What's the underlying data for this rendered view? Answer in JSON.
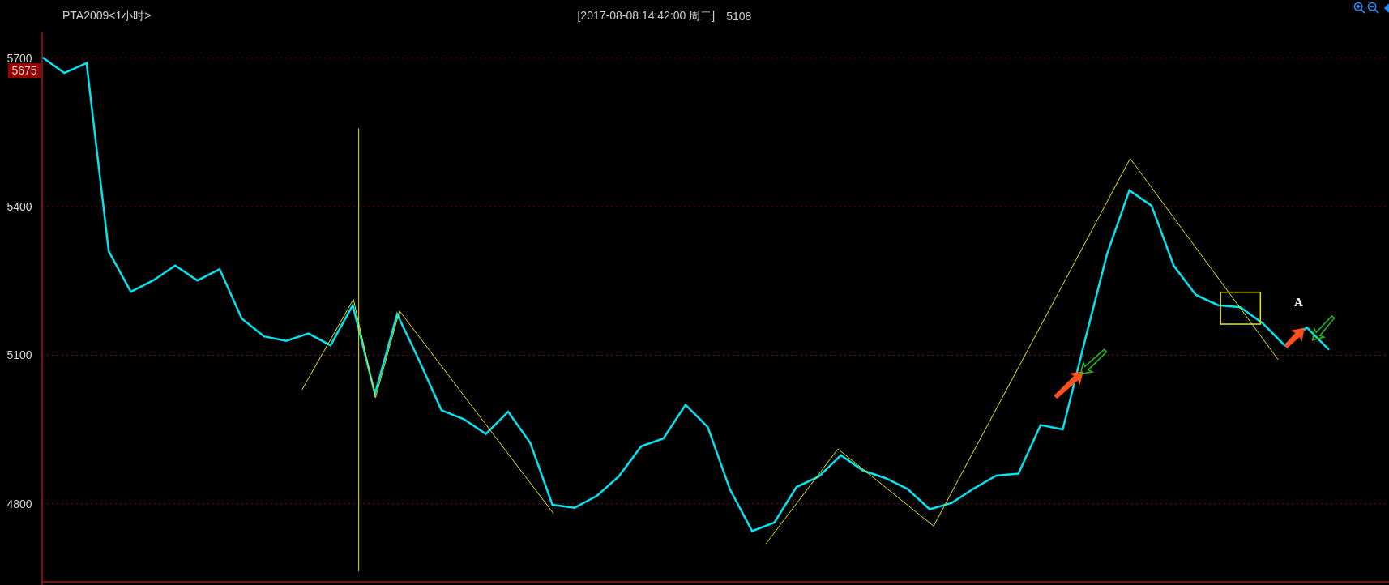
{
  "header": {
    "title": "PTA2009<1小时>",
    "datetime": "[2017-08-08  14:42:00 周二]",
    "price": "5108"
  },
  "chart": {
    "price_tag": "5675",
    "chart_data": {
      "type": "line",
      "grid": true,
      "ylim": [
        4636,
        5752
      ],
      "yticks": [
        {
          "value": 4800,
          "label": "4800"
        },
        {
          "value": 5100,
          "label": "5100"
        },
        {
          "value": 5400,
          "label": "5400"
        },
        {
          "value": 5700,
          "label": "5700"
        }
      ],
      "categories": [
        null,
        null,
        null,
        null,
        null,
        null,
        null,
        null,
        null,
        null,
        null,
        null,
        null,
        null,
        null,
        null,
        null,
        null,
        null,
        null,
        null,
        null,
        null,
        null,
        null,
        null,
        null,
        null,
        null,
        null,
        null,
        null,
        null,
        null,
        null,
        null,
        null,
        null,
        null,
        null,
        null,
        null,
        null,
        null,
        null,
        null,
        null,
        null,
        null,
        null,
        null,
        null,
        null,
        null,
        null,
        null,
        null,
        null,
        null
      ],
      "series": [
        {
          "color": "#00e5f0",
          "values": [
            5702,
            5670,
            5690,
            5310,
            5228,
            5251,
            5281,
            5251,
            5274,
            5174,
            5138,
            5129,
            5144,
            5120,
            5201,
            5022,
            5183,
            5089,
            4989,
            4971,
            4941,
            4986,
            4923,
            4798,
            4792,
            4816,
            4856,
            4916,
            4932,
            5000,
            4955,
            4829,
            4745,
            4762,
            4834,
            4855,
            4898,
            4867,
            4852,
            4830,
            4789,
            4802,
            4831,
            4857,
            4861,
            4959,
            4950,
            5130,
            5305,
            5433,
            5402,
            5281,
            5222,
            5201,
            5197,
            5165,
            5120,
            5156,
            5111
          ]
        }
      ],
      "annotations": [
        {
          "text": "A"
        }
      ]
    }
  }
}
